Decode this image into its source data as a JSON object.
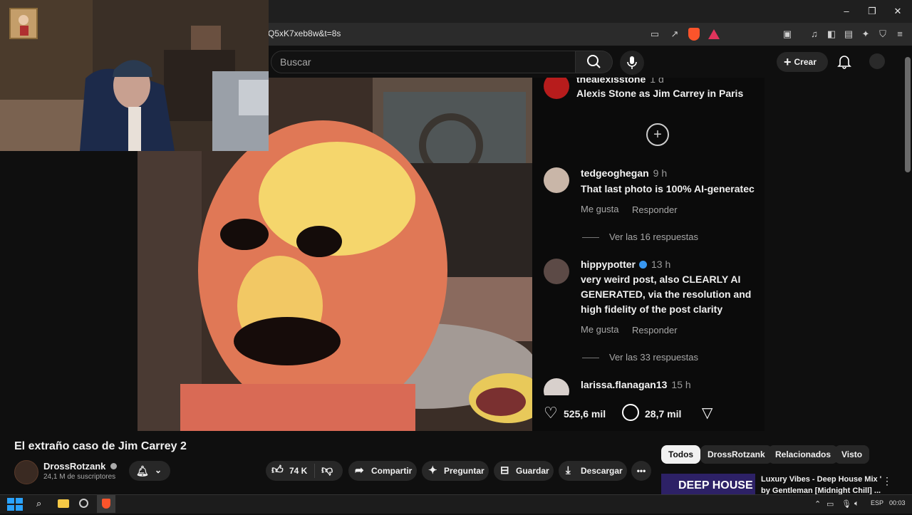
{
  "browser": {
    "url_fragment": "Q5xK7xeb8w&t=8s",
    "window_controls": {
      "minimize": "–",
      "maximize": "❐",
      "close": "✕"
    }
  },
  "header": {
    "search_placeholder": "Buscar",
    "create_label": "Crear"
  },
  "video_overlay": {
    "comments": [
      {
        "user": "thealexisstone",
        "time": "1 d",
        "text": [
          "Alexis Stone as Jim Carrey in Paris"
        ],
        "verified": true
      },
      {
        "user": "tedgeoghegan",
        "time": "9 h",
        "text": [
          "That last photo is 100% AI-generatec"
        ],
        "like": "Me gusta",
        "reply": "Responder",
        "replies": "Ver las 16 respuestas"
      },
      {
        "user": "hippypotter",
        "time": "13 h",
        "text": [
          "very weird post, also CLEARLY AI",
          "GENERATED, via the resolution and",
          "high fidelity of the post clarity"
        ],
        "verified": true,
        "like": "Me gusta",
        "reply": "Responder",
        "replies": "Ver las 33 respuestas"
      },
      {
        "user": "larissa.flanagan13",
        "time": "15 h"
      }
    ],
    "likes": "525,6 mil",
    "comments_count": "28,7 mil"
  },
  "video": {
    "title": "El extraño caso de Jim Carrey 2",
    "channel": "DrossRotzank",
    "subscribers": "24,1 M de suscriptores",
    "like_count": "74 K",
    "share_label": "Compartir",
    "ask_label": "Preguntar",
    "save_label": "Guardar",
    "download_label": "Descargar"
  },
  "chips": [
    "Todos",
    "DrossRotzank",
    "Relacionados",
    "Visto"
  ],
  "recommended": {
    "thumb_text": "DEEP HOUSE",
    "title_line1": "Luxury Vibes - Deep House Mix '",
    "title_line2": "by Gentleman [Midnight Chill] ..."
  },
  "taskbar": {
    "lang": "ESP",
    "time": "00:03"
  },
  "colors": {
    "bg": "#0f0f0f",
    "pill": "#272727",
    "verified_blue": "#3897f0",
    "brave_orange": "#fb542b"
  }
}
